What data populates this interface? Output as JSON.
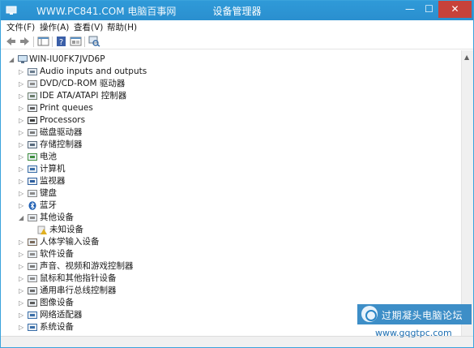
{
  "window": {
    "watermark": "WWW.PC841.COM 电脑百事网",
    "title": "设备管理器",
    "min_glyph": "—",
    "max_glyph": "☐",
    "close_glyph": "✕"
  },
  "menu": {
    "file": "文件(F)",
    "action": "操作(A)",
    "view": "查看(V)",
    "help": "帮助(H)"
  },
  "toolbar": {
    "icons": [
      "back-icon",
      "forward-icon",
      "show-hide-console-tree-icon",
      "help-icon",
      "properties-icon",
      "scan-hardware-icon"
    ]
  },
  "tree": {
    "root": "WIN-IU0FK7JVD6P",
    "items": [
      {
        "label": "Audio inputs and outputs",
        "icon": "speaker-icon",
        "expanded": false
      },
      {
        "label": "DVD/CD-ROM 驱动器",
        "icon": "optical-drive-icon",
        "expanded": false
      },
      {
        "label": "IDE ATA/ATAPI 控制器",
        "icon": "ide-controller-icon",
        "expanded": false
      },
      {
        "label": "Print queues",
        "icon": "printer-icon",
        "expanded": false
      },
      {
        "label": "Processors",
        "icon": "processor-icon",
        "expanded": false
      },
      {
        "label": "磁盘驱动器",
        "icon": "disk-drive-icon",
        "expanded": false
      },
      {
        "label": "存储控制器",
        "icon": "storage-controller-icon",
        "expanded": false
      },
      {
        "label": "电池",
        "icon": "battery-icon",
        "expanded": false
      },
      {
        "label": "计算机",
        "icon": "computer-icon",
        "expanded": false
      },
      {
        "label": "监视器",
        "icon": "monitor-icon",
        "expanded": false
      },
      {
        "label": "键盘",
        "icon": "keyboard-icon",
        "expanded": false
      },
      {
        "label": "蓝牙",
        "icon": "bluetooth-icon",
        "expanded": false
      },
      {
        "label": "其他设备",
        "icon": "other-devices-icon",
        "expanded": true
      },
      {
        "label": "未知设备",
        "icon": "unknown-device-warning-icon",
        "child": true
      },
      {
        "label": "人体学输入设备",
        "icon": "hid-icon",
        "expanded": false
      },
      {
        "label": "软件设备",
        "icon": "software-device-icon",
        "expanded": false
      },
      {
        "label": "声音、视频和游戏控制器",
        "icon": "sound-video-game-icon",
        "expanded": false
      },
      {
        "label": "鼠标和其他指针设备",
        "icon": "mouse-icon",
        "expanded": false
      },
      {
        "label": "通用串行总线控制器",
        "icon": "usb-icon",
        "expanded": false
      },
      {
        "label": "图像设备",
        "icon": "imaging-device-icon",
        "expanded": false
      },
      {
        "label": "网络适配器",
        "icon": "network-adapter-icon",
        "expanded": false
      },
      {
        "label": "系统设备",
        "icon": "system-device-icon",
        "expanded": false
      }
    ]
  },
  "overlay": {
    "logo_text": "过期凝头电脑论坛",
    "url": "www.gqgtpc.com"
  },
  "colors": {
    "titlebar": "#2a8fcf",
    "close": "#c7423a",
    "accent": "#3d8ec7"
  }
}
